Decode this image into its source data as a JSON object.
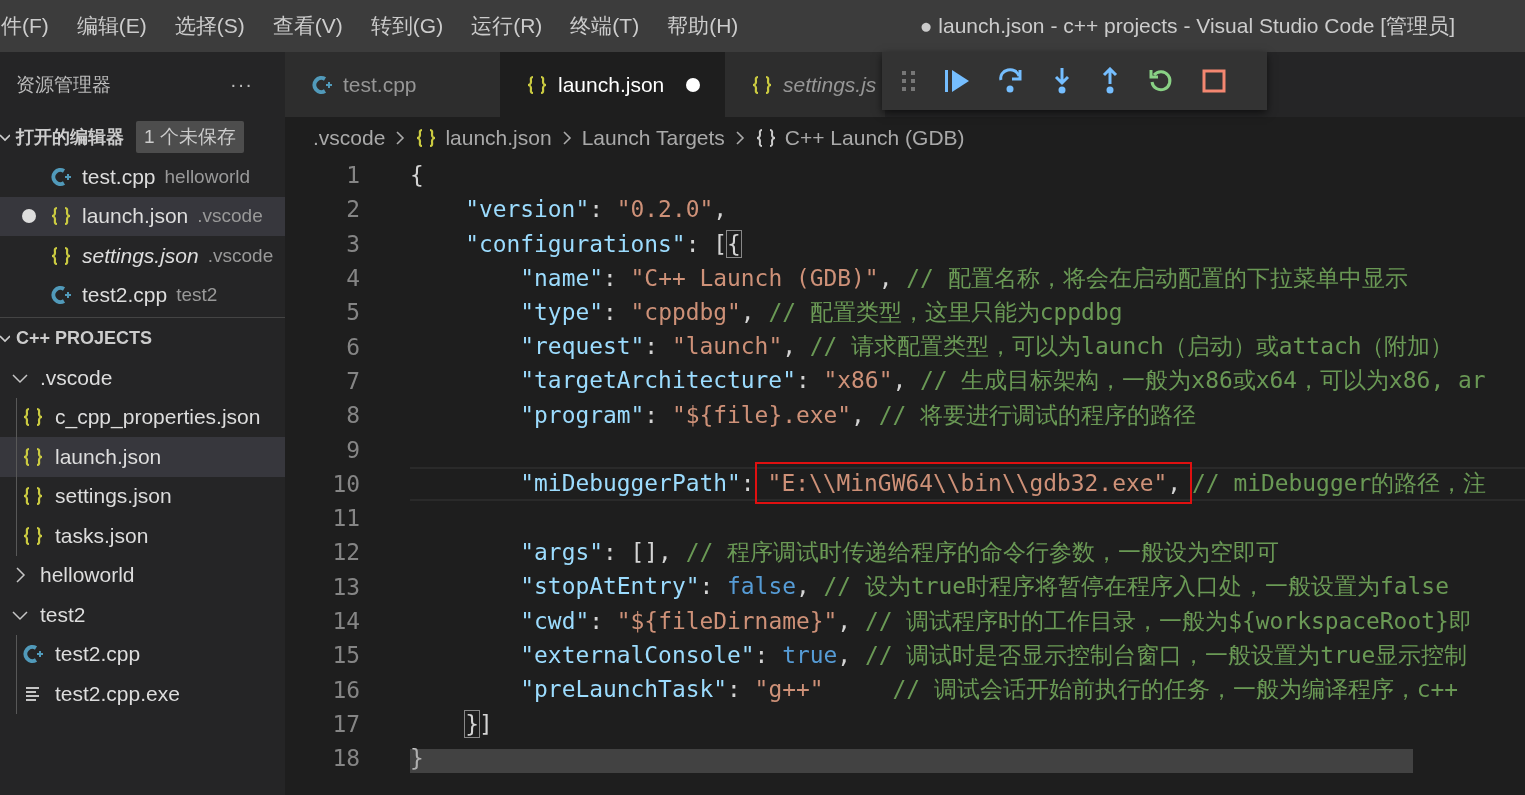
{
  "menu_bar": {
    "items": [
      "件(F)",
      "编辑(E)",
      "选择(S)",
      "查看(V)",
      "转到(G)",
      "运行(R)",
      "终端(T)",
      "帮助(H)"
    ],
    "title": "● launch.json - c++ projects - Visual Studio Code [管理员]"
  },
  "sidebar": {
    "title": "资源管理器",
    "more": "···",
    "open_editors": {
      "title": "打开的编辑器",
      "expanded": true,
      "badge": "1 个未保存",
      "items": [
        {
          "name": "test.cpp",
          "description": "helloworld",
          "kind": "cpp",
          "dirty": false,
          "preview": false,
          "selected": false
        },
        {
          "name": "launch.json",
          "description": ".vscode",
          "kind": "json",
          "dirty": true,
          "preview": false,
          "selected": true
        },
        {
          "name": "settings.json",
          "description": ".vscode",
          "kind": "json",
          "dirty": false,
          "preview": true,
          "selected": false
        },
        {
          "name": "test2.cpp",
          "description": "test2",
          "kind": "cpp",
          "dirty": false,
          "preview": false,
          "selected": false
        }
      ]
    },
    "project": {
      "title": "C++ PROJECTS",
      "expanded": true,
      "items": [
        {
          "name": ".vscode",
          "kind": "folder",
          "expanded": true,
          "selected": false,
          "children": [
            {
              "name": "c_cpp_properties.json",
              "kind": "json",
              "selected": false
            },
            {
              "name": "launch.json",
              "kind": "json",
              "selected": true
            },
            {
              "name": "settings.json",
              "kind": "json",
              "selected": false
            },
            {
              "name": "tasks.json",
              "kind": "json",
              "selected": false
            }
          ]
        },
        {
          "name": "helloworld",
          "kind": "folder",
          "expanded": false,
          "selected": false
        },
        {
          "name": "test2",
          "kind": "folder",
          "expanded": true,
          "selected": false,
          "children": [
            {
              "name": "test2.cpp",
              "kind": "cpp",
              "selected": false
            },
            {
              "name": "test2.cpp.exe",
              "kind": "exe",
              "selected": false
            }
          ]
        }
      ]
    }
  },
  "tabs": [
    {
      "label": "test.cpp",
      "kind": "cpp",
      "selected": false,
      "dirty": false,
      "preview": false
    },
    {
      "label": "launch.json",
      "kind": "json",
      "selected": true,
      "dirty": true,
      "preview": false
    },
    {
      "label": "settings.js",
      "kind": "json",
      "selected": false,
      "dirty": false,
      "preview": true
    }
  ],
  "breadcrumbs": [
    {
      "label": ".vscode",
      "kind": "folder"
    },
    {
      "label": "launch.json",
      "kind": "json"
    },
    {
      "label": "Launch Targets",
      "kind": "section"
    },
    {
      "label": "C++ Launch (GDB)",
      "kind": "object"
    }
  ],
  "editor": {
    "lines": [
      {
        "number": "1",
        "tokens": [
          {
            "kind": "punct",
            "text": "{"
          }
        ],
        "children": [
          {
            "number": "2",
            "tokens": [
              {
                "kind": "key",
                "text": "\"version\""
              },
              {
                "kind": "punct",
                "text": ": "
              },
              {
                "kind": "string",
                "text": "\"0.2.0\""
              },
              {
                "kind": "punct",
                "text": ","
              }
            ]
          },
          {
            "number": "3",
            "tokens": [
              {
                "kind": "key",
                "text": "\"configurations\""
              },
              {
                "kind": "punct",
                "text": ": ["
              },
              {
                "kind": "bracket",
                "text": "{"
              }
            ],
            "children": [
              {
                "number": "4",
                "tokens": [
                  {
                    "kind": "key",
                    "text": "\"name\""
                  },
                  {
                    "kind": "punct",
                    "text": ": "
                  },
                  {
                    "kind": "string",
                    "text": "\"C++ Launch (GDB)\""
                  },
                  {
                    "kind": "punct",
                    "text": ", "
                  },
                  {
                    "kind": "comment",
                    "text": "// 配置名称，将会在启动配置的下拉菜单中显示"
                  }
                ]
              },
              {
                "number": "5",
                "tokens": [
                  {
                    "kind": "key",
                    "text": "\"type\""
                  },
                  {
                    "kind": "punct",
                    "text": ": "
                  },
                  {
                    "kind": "string",
                    "text": "\"cppdbg\""
                  },
                  {
                    "kind": "punct",
                    "text": ", "
                  },
                  {
                    "kind": "comment",
                    "text": "// 配置类型，这里只能为cppdbg"
                  }
                ]
              },
              {
                "number": "6",
                "tokens": [
                  {
                    "kind": "key",
                    "text": "\"request\""
                  },
                  {
                    "kind": "punct",
                    "text": ": "
                  },
                  {
                    "kind": "string",
                    "text": "\"launch\""
                  },
                  {
                    "kind": "punct",
                    "text": ", "
                  },
                  {
                    "kind": "comment",
                    "text": "// 请求配置类型，可以为launch（启动）或attach（附加）"
                  }
                ]
              },
              {
                "number": "7",
                "tokens": [
                  {
                    "kind": "key",
                    "text": "\"targetArchitecture\""
                  },
                  {
                    "kind": "punct",
                    "text": ": "
                  },
                  {
                    "kind": "string",
                    "text": "\"x86\""
                  },
                  {
                    "kind": "punct",
                    "text": ", "
                  },
                  {
                    "kind": "comment",
                    "text": "// 生成目标架构，一般为x86或x64，可以为x86, ar"
                  }
                ]
              },
              {
                "number": "8",
                "tokens": [
                  {
                    "kind": "key",
                    "text": "\"program\""
                  },
                  {
                    "kind": "punct",
                    "text": ": "
                  },
                  {
                    "kind": "string",
                    "text": "\"${file}.exe\""
                  },
                  {
                    "kind": "punct",
                    "text": ", "
                  },
                  {
                    "kind": "comment",
                    "text": "// 将要进行调试的程序的路径"
                  }
                ]
              },
              {
                "number": "9"
              },
              {
                "number": "10",
                "current": true,
                "tokens": [
                  {
                    "kind": "key",
                    "text": "\"miDebuggerPath\""
                  },
                  {
                    "kind": "punct",
                    "text": ":"
                  },
                  {
                    "kind": "box",
                    "tokens": [
                      {
                        "kind": "string",
                        "text": "\"E:\\\\MinGW64\\\\bin\\\\gdb32.exe\""
                      },
                      {
                        "kind": "punct",
                        "text": ","
                      }
                    ]
                  },
                  {
                    "kind": "comment",
                    "text": "// miDebugger的路径，注"
                  }
                ]
              },
              {
                "number": "11"
              },
              {
                "number": "12",
                "tokens": [
                  {
                    "kind": "key",
                    "text": "\"args\""
                  },
                  {
                    "kind": "punct",
                    "text": ": [], "
                  },
                  {
                    "kind": "comment",
                    "text": "// 程序调试时传递给程序的命令行参数，一般设为空即可"
                  }
                ]
              },
              {
                "number": "13",
                "tokens": [
                  {
                    "kind": "key",
                    "text": "\"stopAtEntry\""
                  },
                  {
                    "kind": "punct",
                    "text": ": "
                  },
                  {
                    "kind": "bool",
                    "text": "false"
                  },
                  {
                    "kind": "punct",
                    "text": ", "
                  },
                  {
                    "kind": "comment",
                    "text": "// 设为true时程序将暂停在程序入口处，一般设置为false"
                  }
                ]
              },
              {
                "number": "14",
                "tokens": [
                  {
                    "kind": "key",
                    "text": "\"cwd\""
                  },
                  {
                    "kind": "punct",
                    "text": ": "
                  },
                  {
                    "kind": "string",
                    "text": "\"${fileDirname}\""
                  },
                  {
                    "kind": "punct",
                    "text": ", "
                  },
                  {
                    "kind": "comment",
                    "text": "// 调试程序时的工作目录，一般为${workspaceRoot}即"
                  }
                ]
              },
              {
                "number": "15",
                "tokens": [
                  {
                    "kind": "key",
                    "text": "\"externalConsole\""
                  },
                  {
                    "kind": "punct",
                    "text": ": "
                  },
                  {
                    "kind": "bool",
                    "text": "true"
                  },
                  {
                    "kind": "punct",
                    "text": ", "
                  },
                  {
                    "kind": "comment",
                    "text": "// 调试时是否显示控制台窗口，一般设置为true显示控制"
                  }
                ]
              },
              {
                "number": "16",
                "tokens": [
                  {
                    "kind": "key",
                    "text": "\"preLaunchTask\""
                  },
                  {
                    "kind": "punct",
                    "text": ": "
                  },
                  {
                    "kind": "string",
                    "text": "\"g++\""
                  },
                  {
                    "kind": "comment",
                    "text": "     // 调试会话开始前执行的任务，一般为编译程序，c++"
                  }
                ]
              }
            ]
          },
          {
            "number": "17",
            "tokens": [
              {
                "kind": "bracket",
                "text": "}"
              },
              {
                "kind": "punct",
                "text": "]"
              }
            ]
          }
        ]
      },
      {
        "number": "18",
        "tokens": [
          {
            "kind": "punct",
            "text": "}"
          }
        ]
      }
    ]
  }
}
